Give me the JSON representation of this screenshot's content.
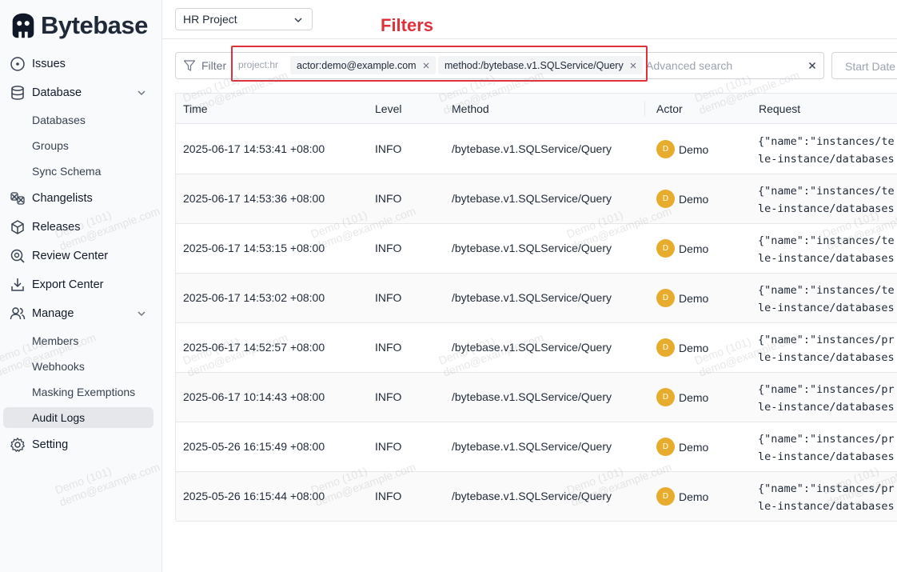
{
  "app": {
    "name": "Bytebase"
  },
  "sidebar": {
    "items": [
      {
        "label": "Issues",
        "icon": "issues-icon"
      },
      {
        "label": "Database",
        "icon": "database-icon",
        "expanded": true,
        "children": [
          "Databases",
          "Groups",
          "Sync Schema"
        ]
      },
      {
        "label": "Changelists",
        "icon": "changelists-icon"
      },
      {
        "label": "Releases",
        "icon": "releases-icon"
      },
      {
        "label": "Review Center",
        "icon": "review-center-icon"
      },
      {
        "label": "Export Center",
        "icon": "export-center-icon"
      },
      {
        "label": "Manage",
        "icon": "manage-icon",
        "expanded": true,
        "children": [
          "Members",
          "Webhooks",
          "Masking Exemptions",
          "Audit Logs"
        ]
      },
      {
        "label": "Setting",
        "icon": "setting-icon"
      }
    ],
    "active": "Audit Logs"
  },
  "project_select": {
    "value": "HR Project"
  },
  "annotation": {
    "label": "Filters",
    "color": "#e0303a"
  },
  "filter": {
    "label": "Filter",
    "scope": "project:hr",
    "chips": [
      "actor:demo@example.com",
      "method:/bytebase.v1.SQLService/Query"
    ],
    "placeholder": "Advanced search"
  },
  "date": {
    "placeholder": "Start Date"
  },
  "table": {
    "columns": [
      "Time",
      "Level",
      "Method",
      "Actor",
      "Request"
    ],
    "rows": [
      {
        "time": "2025-06-17 14:53:41 +08:00",
        "level": "INFO",
        "method": "/bytebase.v1.SQLService/Query",
        "actor": "Demo",
        "avatar": "D",
        "req1": "{\"name\":\"instances/te",
        "req2": "le-instance/databases"
      },
      {
        "time": "2025-06-17 14:53:36 +08:00",
        "level": "INFO",
        "method": "/bytebase.v1.SQLService/Query",
        "actor": "Demo",
        "avatar": "D",
        "req1": "{\"name\":\"instances/te",
        "req2": "le-instance/databases"
      },
      {
        "time": "2025-06-17 14:53:15 +08:00",
        "level": "INFO",
        "method": "/bytebase.v1.SQLService/Query",
        "actor": "Demo",
        "avatar": "D",
        "req1": "{\"name\":\"instances/te",
        "req2": "le-instance/databases"
      },
      {
        "time": "2025-06-17 14:53:02 +08:00",
        "level": "INFO",
        "method": "/bytebase.v1.SQLService/Query",
        "actor": "Demo",
        "avatar": "D",
        "req1": "{\"name\":\"instances/te",
        "req2": "le-instance/databases"
      },
      {
        "time": "2025-06-17 14:52:57 +08:00",
        "level": "INFO",
        "method": "/bytebase.v1.SQLService/Query",
        "actor": "Demo",
        "avatar": "D",
        "req1": "{\"name\":\"instances/pr",
        "req2": "le-instance/databases"
      },
      {
        "time": "2025-06-17 10:14:43 +08:00",
        "level": "INFO",
        "method": "/bytebase.v1.SQLService/Query",
        "actor": "Demo",
        "avatar": "D",
        "req1": "{\"name\":\"instances/pr",
        "req2": "le-instance/databases"
      },
      {
        "time": "2025-05-26 16:15:49 +08:00",
        "level": "INFO",
        "method": "/bytebase.v1.SQLService/Query",
        "actor": "Demo",
        "avatar": "D",
        "req1": "{\"name\":\"instances/pr",
        "req2": "le-instance/databases"
      },
      {
        "time": "2025-05-26 16:15:44 +08:00",
        "level": "INFO",
        "method": "/bytebase.v1.SQLService/Query",
        "actor": "Demo",
        "avatar": "D",
        "req1": "{\"name\":\"instances/pr",
        "req2": "le-instance/databases"
      }
    ]
  },
  "watermark": {
    "line1": "Demo (101)",
    "line2": "demo@example.com"
  }
}
